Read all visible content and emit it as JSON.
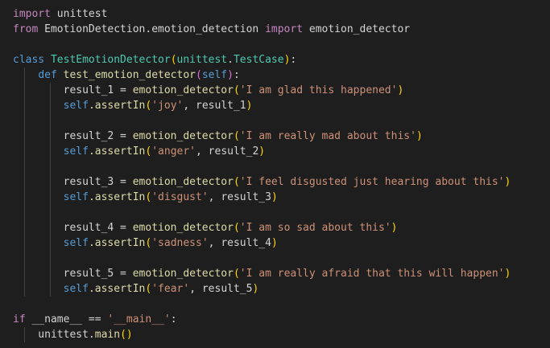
{
  "lines": [
    {
      "tokens": [
        {
          "t": "import",
          "c": "kw"
        },
        {
          "t": " unittest",
          "c": "txt"
        }
      ]
    },
    {
      "tokens": [
        {
          "t": "from",
          "c": "kw"
        },
        {
          "t": " EmotionDetection.emotion_detection ",
          "c": "txt"
        },
        {
          "t": "import",
          "c": "kw"
        },
        {
          "t": " emotion_detector",
          "c": "txt"
        }
      ]
    },
    {
      "tokens": []
    },
    {
      "tokens": [
        {
          "t": "class",
          "c": "kwd"
        },
        {
          "t": " ",
          "c": "txt"
        },
        {
          "t": "TestEmotionDetector",
          "c": "cls"
        },
        {
          "t": "(",
          "c": "par"
        },
        {
          "t": "unittest",
          "c": "cls"
        },
        {
          "t": ".",
          "c": "txt"
        },
        {
          "t": "TestCase",
          "c": "cls"
        },
        {
          "t": ")",
          "c": "par"
        },
        {
          "t": ":",
          "c": "txt"
        }
      ]
    },
    {
      "guides": 1,
      "tokens": [
        {
          "t": "    ",
          "c": "txt"
        },
        {
          "t": "def",
          "c": "kwd"
        },
        {
          "t": " ",
          "c": "txt"
        },
        {
          "t": "test_emotion_detector",
          "c": "fn"
        },
        {
          "t": "(",
          "c": "par2"
        },
        {
          "t": "self",
          "c": "slf"
        },
        {
          "t": ")",
          "c": "par2"
        },
        {
          "t": ":",
          "c": "txt"
        }
      ]
    },
    {
      "guides": 2,
      "tokens": [
        {
          "t": "        result_1 = ",
          "c": "txt"
        },
        {
          "t": "emotion_detector",
          "c": "fn"
        },
        {
          "t": "(",
          "c": "par"
        },
        {
          "t": "'I am glad this happened'",
          "c": "str"
        },
        {
          "t": ")",
          "c": "par"
        }
      ]
    },
    {
      "guides": 2,
      "tokens": [
        {
          "t": "        ",
          "c": "txt"
        },
        {
          "t": "self",
          "c": "slf"
        },
        {
          "t": ".assertIn",
          "c": "fn"
        },
        {
          "t": "(",
          "c": "par"
        },
        {
          "t": "'joy'",
          "c": "str"
        },
        {
          "t": ", result_1",
          "c": "txt"
        },
        {
          "t": ")",
          "c": "par"
        }
      ]
    },
    {
      "guides": 2,
      "tokens": []
    },
    {
      "guides": 2,
      "tokens": [
        {
          "t": "        result_2 = ",
          "c": "txt"
        },
        {
          "t": "emotion_detector",
          "c": "fn"
        },
        {
          "t": "(",
          "c": "par"
        },
        {
          "t": "'I am really mad about this'",
          "c": "str"
        },
        {
          "t": ")",
          "c": "par"
        }
      ]
    },
    {
      "guides": 2,
      "tokens": [
        {
          "t": "        ",
          "c": "txt"
        },
        {
          "t": "self",
          "c": "slf"
        },
        {
          "t": ".assertIn",
          "c": "fn"
        },
        {
          "t": "(",
          "c": "par"
        },
        {
          "t": "'anger'",
          "c": "str"
        },
        {
          "t": ", result_2",
          "c": "txt"
        },
        {
          "t": ")",
          "c": "par"
        }
      ]
    },
    {
      "guides": 2,
      "tokens": []
    },
    {
      "guides": 2,
      "tokens": [
        {
          "t": "        result_3 = ",
          "c": "txt"
        },
        {
          "t": "emotion_detector",
          "c": "fn"
        },
        {
          "t": "(",
          "c": "par"
        },
        {
          "t": "'I feel disgusted just hearing about this'",
          "c": "str"
        },
        {
          "t": ")",
          "c": "par"
        }
      ]
    },
    {
      "guides": 2,
      "tokens": [
        {
          "t": "        ",
          "c": "txt"
        },
        {
          "t": "self",
          "c": "slf"
        },
        {
          "t": ".assertIn",
          "c": "fn"
        },
        {
          "t": "(",
          "c": "par"
        },
        {
          "t": "'disgust'",
          "c": "str"
        },
        {
          "t": ", result_3",
          "c": "txt"
        },
        {
          "t": ")",
          "c": "par"
        }
      ]
    },
    {
      "guides": 2,
      "tokens": []
    },
    {
      "guides": 2,
      "tokens": [
        {
          "t": "        result_4 = ",
          "c": "txt"
        },
        {
          "t": "emotion_detector",
          "c": "fn"
        },
        {
          "t": "(",
          "c": "par"
        },
        {
          "t": "'I am so sad about this'",
          "c": "str"
        },
        {
          "t": ")",
          "c": "par"
        }
      ]
    },
    {
      "guides": 2,
      "tokens": [
        {
          "t": "        ",
          "c": "txt"
        },
        {
          "t": "self",
          "c": "slf"
        },
        {
          "t": ".assertIn",
          "c": "fn"
        },
        {
          "t": "(",
          "c": "par"
        },
        {
          "t": "'sadness'",
          "c": "str"
        },
        {
          "t": ", result_4",
          "c": "txt"
        },
        {
          "t": ")",
          "c": "par"
        }
      ]
    },
    {
      "guides": 2,
      "tokens": []
    },
    {
      "guides": 2,
      "tokens": [
        {
          "t": "        result_5 = ",
          "c": "txt"
        },
        {
          "t": "emotion_detector",
          "c": "fn"
        },
        {
          "t": "(",
          "c": "par"
        },
        {
          "t": "'I am really afraid that this will happen'",
          "c": "str"
        },
        {
          "t": ")",
          "c": "par"
        }
      ]
    },
    {
      "guides": 2,
      "tokens": [
        {
          "t": "        ",
          "c": "txt"
        },
        {
          "t": "self",
          "c": "slf"
        },
        {
          "t": ".assertIn",
          "c": "fn"
        },
        {
          "t": "(",
          "c": "par"
        },
        {
          "t": "'fear'",
          "c": "str"
        },
        {
          "t": ", result_5",
          "c": "txt"
        },
        {
          "t": ")",
          "c": "par"
        }
      ]
    },
    {
      "tokens": []
    },
    {
      "tokens": [
        {
          "t": "if",
          "c": "kw"
        },
        {
          "t": " __name__ == ",
          "c": "txt"
        },
        {
          "t": "'__main__'",
          "c": "str"
        },
        {
          "t": ":",
          "c": "txt"
        }
      ]
    },
    {
      "guides": 1,
      "tokens": [
        {
          "t": "    unittest.",
          "c": "txt"
        },
        {
          "t": "main",
          "c": "fn"
        },
        {
          "t": "()",
          "c": "par"
        }
      ]
    }
  ]
}
